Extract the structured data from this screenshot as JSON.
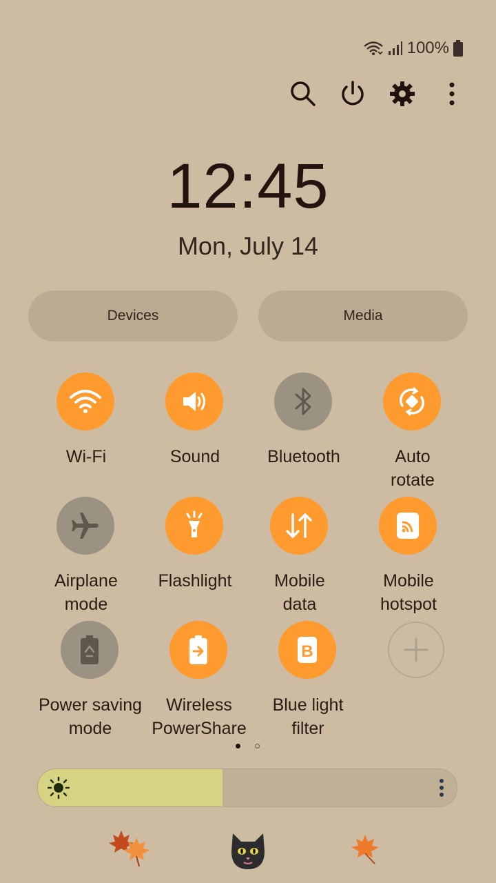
{
  "status_bar": {
    "battery_text": "100%",
    "icons": [
      "wifi-call-icon",
      "signal-icon",
      "battery-icon"
    ]
  },
  "top_actions": [
    {
      "name": "search-icon"
    },
    {
      "name": "power-icon"
    },
    {
      "name": "settings-icon"
    },
    {
      "name": "more-options-icon"
    }
  ],
  "clock": {
    "time": "12:45",
    "date": "Mon, July 14"
  },
  "pills": {
    "devices": "Devices",
    "media": "Media"
  },
  "tiles": [
    {
      "label_line1": "Wi-Fi",
      "label_line2": "",
      "state": "on",
      "icon": "wifi-icon"
    },
    {
      "label_line1": "Sound",
      "label_line2": "",
      "state": "on",
      "icon": "sound-icon"
    },
    {
      "label_line1": "Bluetooth",
      "label_line2": "",
      "state": "off",
      "icon": "bluetooth-icon"
    },
    {
      "label_line1": "Auto",
      "label_line2": "rotate",
      "state": "on",
      "icon": "auto-rotate-icon"
    },
    {
      "label_line1": "Airplane",
      "label_line2": "mode",
      "state": "off",
      "icon": "airplane-icon"
    },
    {
      "label_line1": "Flashlight",
      "label_line2": "",
      "state": "on",
      "icon": "flashlight-icon"
    },
    {
      "label_line1": "Mobile",
      "label_line2": "data",
      "state": "on",
      "icon": "mobile-data-icon"
    },
    {
      "label_line1": "Mobile",
      "label_line2": "hotspot",
      "state": "on",
      "icon": "hotspot-icon"
    },
    {
      "label_line1": "Power saving",
      "label_line2": "mode",
      "state": "off",
      "icon": "power-saving-icon"
    },
    {
      "label_line1": "Wireless",
      "label_line2": "PowerShare",
      "state": "on",
      "icon": "wireless-powershare-icon"
    },
    {
      "label_line1": "Blue light",
      "label_line2": "filter",
      "state": "on",
      "icon": "blue-light-filter-icon"
    },
    {
      "label_line1": "",
      "label_line2": "",
      "state": "add",
      "icon": "add-tile-icon"
    }
  ],
  "pager": {
    "pages": 2,
    "active": 1
  },
  "brightness": {
    "level": 0.44
  },
  "colors": {
    "background": "#cdbca1",
    "tile_on": "#ff9a2e",
    "tile_off": "#9b9283",
    "pill": "#bcab92",
    "brightness_fill": "#d6d482"
  }
}
